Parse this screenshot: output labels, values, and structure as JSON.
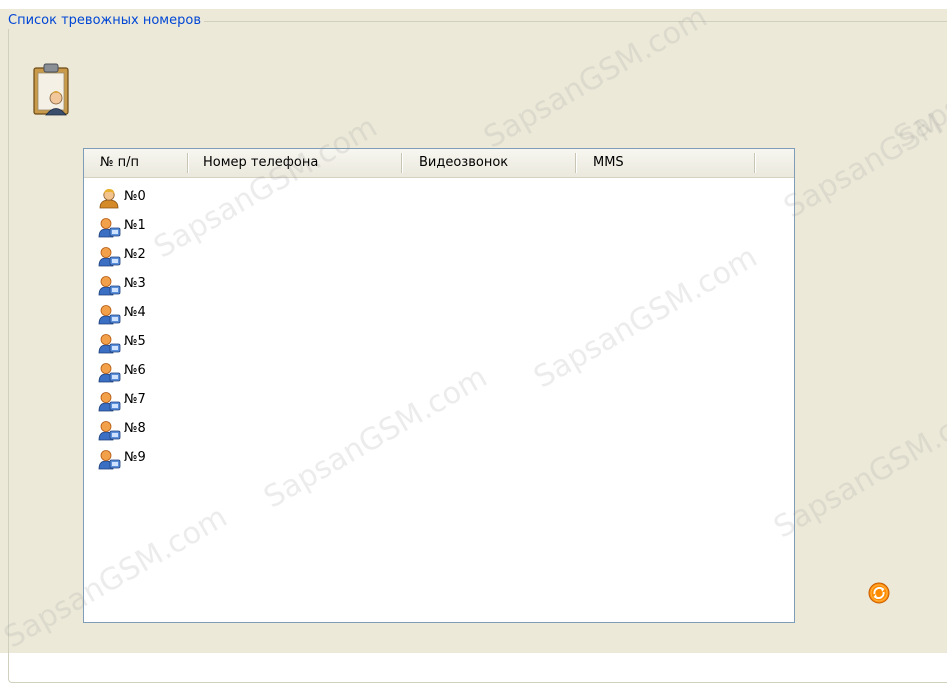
{
  "group": {
    "title": "Список тревожных номеров"
  },
  "icons": {
    "clipboard": "clipboard-user-icon",
    "owner": "owner-user-icon",
    "contact": "contact-user-icon",
    "refresh": "refresh-icon"
  },
  "table": {
    "columns": [
      "№ п/п",
      "Номер телефона",
      "Видеозвонок",
      "MMS"
    ],
    "rows": [
      {
        "label": "№0",
        "icon": "owner-user-icon",
        "phone": "",
        "video_call": "",
        "mms": ""
      },
      {
        "label": "№1",
        "icon": "contact-user-icon",
        "phone": "",
        "video_call": "",
        "mms": ""
      },
      {
        "label": "№2",
        "icon": "contact-user-icon",
        "phone": "",
        "video_call": "",
        "mms": ""
      },
      {
        "label": "№3",
        "icon": "contact-user-icon",
        "phone": "",
        "video_call": "",
        "mms": ""
      },
      {
        "label": "№4",
        "icon": "contact-user-icon",
        "phone": "",
        "video_call": "",
        "mms": ""
      },
      {
        "label": "№5",
        "icon": "contact-user-icon",
        "phone": "",
        "video_call": "",
        "mms": ""
      },
      {
        "label": "№6",
        "icon": "contact-user-icon",
        "phone": "",
        "video_call": "",
        "mms": ""
      },
      {
        "label": "№7",
        "icon": "contact-user-icon",
        "phone": "",
        "video_call": "",
        "mms": ""
      },
      {
        "label": "№8",
        "icon": "contact-user-icon",
        "phone": "",
        "video_call": "",
        "mms": ""
      },
      {
        "label": "№9",
        "icon": "contact-user-icon",
        "phone": "",
        "video_call": "",
        "mms": ""
      }
    ]
  },
  "watermark": {
    "text": "SapsanGSM.com"
  },
  "colors": {
    "group_title": "#0046d5",
    "panel_bg": "#ece9d8",
    "list_border": "#7f9db9",
    "refresh": "#ff8c00"
  }
}
